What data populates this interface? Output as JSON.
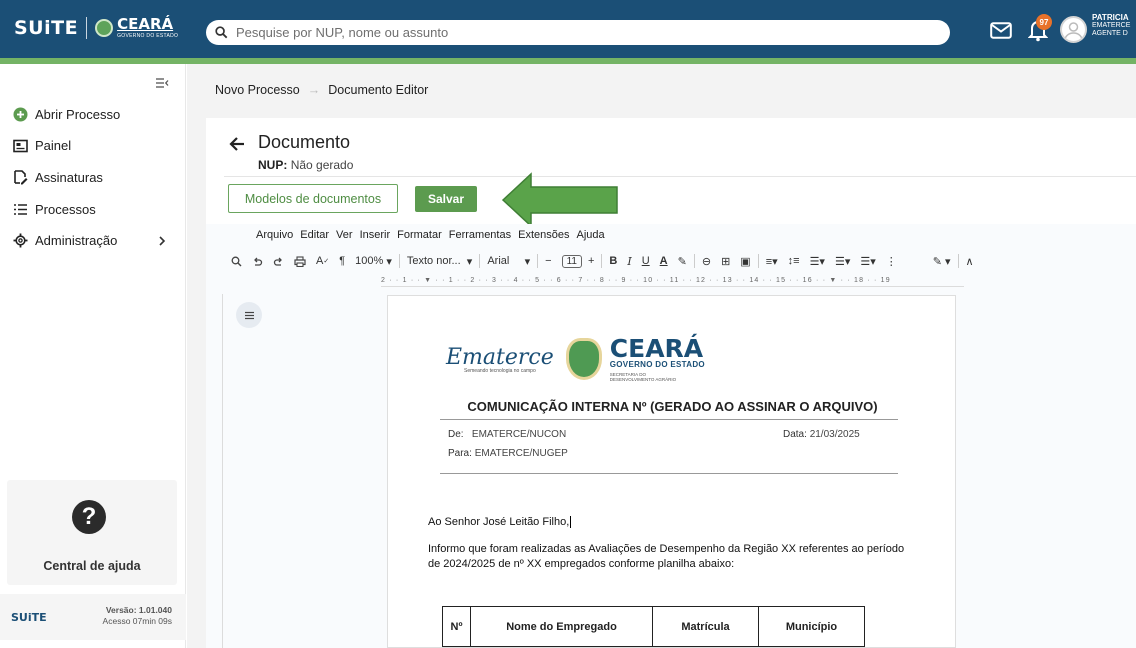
{
  "header": {
    "brand_suite": "SUiTE",
    "brand_ceara": "CEARÁ",
    "brand_gov": "GOVERNO DO ESTADO",
    "search_placeholder": "Pesquise por NUP, nome ou assunto",
    "notification_count": "97",
    "user_name": "PATRICIA",
    "user_org": "EMATERCE",
    "user_role": "AGENTE D"
  },
  "sidebar": {
    "items": [
      {
        "label": "Abrir Processo",
        "icon": "plus-circle-icon"
      },
      {
        "label": "Painel",
        "icon": "dashboard-icon"
      },
      {
        "label": "Assinaturas",
        "icon": "signature-icon"
      },
      {
        "label": "Processos",
        "icon": "list-icon"
      },
      {
        "label": "Administração",
        "icon": "gear-icon"
      }
    ],
    "help_label": "Central de ajuda",
    "version_brand": "SUiTE",
    "version_text": "Versão: 1.01.040",
    "access_text": "Acesso 07min 09s"
  },
  "breadcrumb": {
    "first": "Novo Processo",
    "arrow": "→",
    "second": "Documento Editor"
  },
  "document_header": {
    "title": "Documento",
    "nup_label": "NUP:",
    "nup_value": "Não gerado"
  },
  "actions": {
    "templates_label": "Modelos de documentos",
    "save_label": "Salvar"
  },
  "editor": {
    "menu": [
      "Arquivo",
      "Editar",
      "Ver",
      "Inserir",
      "Formatar",
      "Ferramentas",
      "Extensões",
      "Ajuda"
    ],
    "zoom": "100%",
    "style": "Texto nor...",
    "font": "Arial",
    "font_size": "11",
    "ruler_text": "2 · · 1 · · ▼ · · 1 · · 2 · · 3 · · 4 · · 5 · · 6 · · 7 · · 8 · · 9 · · 10 · · 11 · · 12 · · 13 · · 14 · · 15 · · 16 · · ▼ · · 18 · · 19"
  },
  "doc": {
    "logo_text": "Ematerce",
    "logo_sub": "Semeando tecnologia no campo",
    "ceara": "CEARÁ",
    "gov": "GOVERNO DO ESTADO",
    "secretaria": "SECRETARIA DO DESENVOLVIMENTO AGRÁRIO",
    "title": "COMUNICAÇÃO INTERNA Nº (GERADO AO ASSINAR O ARQUIVO)",
    "from_label": "De:",
    "from_value": "EMATERCE/NUCON",
    "date_label": "Data:",
    "date_value": "21/03/2025",
    "to_label": "Para:",
    "to_value": "EMATERCE/NUGEP",
    "salutation": "Ao Senhor José Leitão Filho,",
    "paragraph": "Informo que foram realizadas as Avaliações de Desempenho da Região XX referentes ao período de 2024/2025 de nº XX empregados conforme planilha abaixo:",
    "table_headers": [
      "Nº",
      "Nome do Empregado",
      "Matrícula",
      "Município"
    ]
  },
  "colors": {
    "topbar": "#1b4f76",
    "accent_green": "#5c9b4f",
    "green_line": "#74b365",
    "badge": "#e8722a"
  }
}
